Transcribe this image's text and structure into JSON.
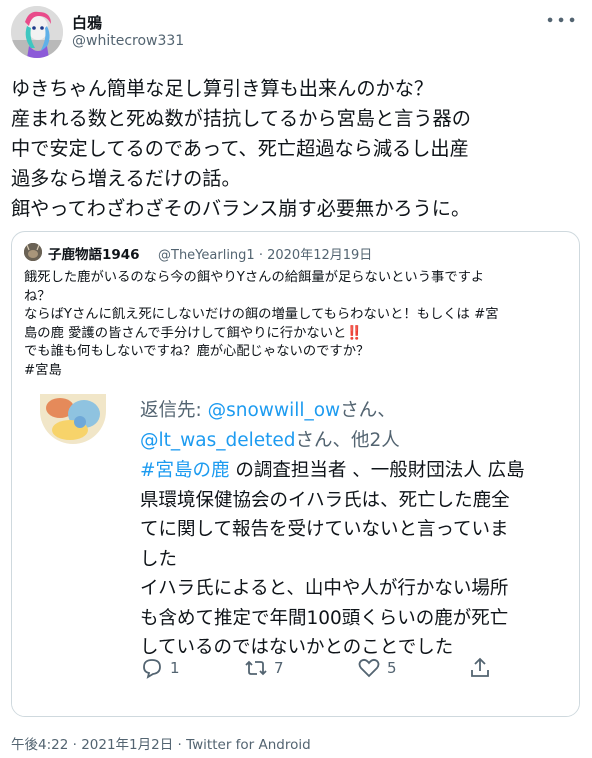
{
  "author": {
    "display_name": "白鴉",
    "handle": "@whitecrow331"
  },
  "more_label": "∙∙∙",
  "tweet_lines": [
    "ゆきちゃん簡単な足し算引き算も出来んのかな？",
    "産まれる数と死ぬ数が拮抗してるから宮島と言う器の",
    "中で安定してるのであって、死亡超過なら減るし出産",
    "過多なら増えるだけの話。",
    "餌やってわざわざそのバランス崩す必要無かろうに。"
  ],
  "quoted": {
    "name": "子鹿物語1946",
    "handle": "@TheYearling1",
    "separator": "·",
    "date": "2020年12月19日",
    "lines": [
      "餓死した鹿がいるのなら今の餌やりYさんの給餌量が足らないという事ですよ",
      "ね？",
      "ならばYさんに飢え死にしないだけの餌の増量してもらわないと！もしくは #宮",
      "島の鹿 愛護の皆さんで手分けして餌やりに行かないと‼️",
      "でも誰も何もしないですね？鹿が心配じゃないのですか？",
      "#宮島"
    ],
    "media": {
      "reply_prefix": "返信先: ",
      "reply_user1": "@snowwill_ow",
      "reply_mid": "さん、",
      "reply_user2": "@lt_was_deleted",
      "reply_suffix": "さん、他2人",
      "hashtag": "#宮島の鹿",
      "line1_rest": " の調査担当者 、一般財団法人 広島",
      "lines": [
        "県環境保健協会のイハラ氏は、死亡した鹿全",
        "てに関して報告を受けていないと言っていま",
        "した",
        "イハラ氏によると、山中や人が行かない場所",
        "も含めて推定で年間100頭くらいの鹿が死亡",
        "しているのではないかとのことでした"
      ],
      "actions": {
        "reply_count": "1",
        "retweet_count": "7",
        "like_count": "5"
      }
    }
  },
  "footer": {
    "time": "午後4:22",
    "sep1": " · ",
    "date": "2021年1月2日",
    "sep2": " · ",
    "source": "Twitter for Android"
  },
  "colors": {
    "text": "#0f1419",
    "secondary": "#536471",
    "link": "#1d9bf0",
    "border": "#cfd9de"
  }
}
